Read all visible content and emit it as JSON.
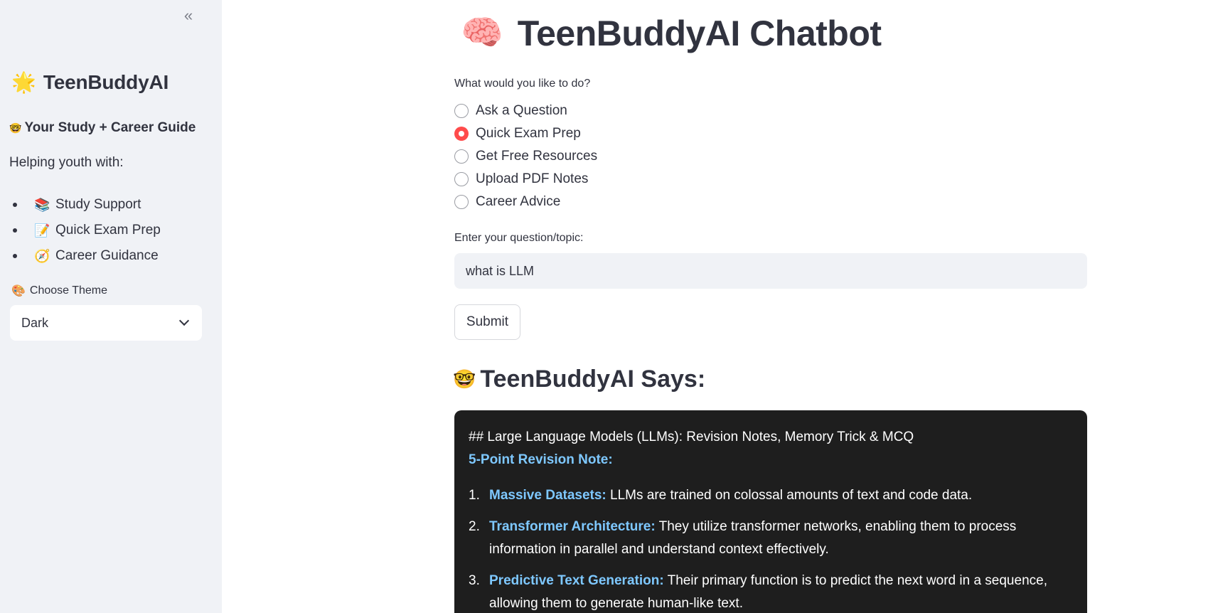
{
  "sidebar": {
    "collapse_icon": "double-chevron-left-icon",
    "collapse_glyph": "«",
    "brand_emoji": "🌟",
    "brand_title": "TeenBuddyAI",
    "tagline_icon": "🤓",
    "tagline": "Your Study + Career Guide",
    "helping_text": "Helping youth with:",
    "features": [
      {
        "icon": "📚",
        "icon_name": "books-icon",
        "label": "Study Support"
      },
      {
        "icon": "📝",
        "icon_name": "memo-icon",
        "label": "Quick Exam Prep"
      },
      {
        "icon": "🧭",
        "icon_name": "compass-icon",
        "label": "Career Guidance"
      }
    ],
    "theme_icon": "🎨",
    "theme_label": "Choose Theme",
    "theme_value": "Dark"
  },
  "main": {
    "title_emoji": "🧠",
    "title": "TeenBuddyAI Chatbot",
    "prompt_label": "What would you like to do?",
    "options": [
      {
        "label": "Ask a Question",
        "selected": false
      },
      {
        "label": "Quick Exam Prep",
        "selected": true
      },
      {
        "label": "Get Free Resources",
        "selected": false
      },
      {
        "label": "Upload PDF Notes",
        "selected": false
      },
      {
        "label": "Career Advice",
        "selected": false
      }
    ],
    "input_label": "Enter your question/topic:",
    "input_value": "what is LLM",
    "submit_label": "Submit",
    "says_icon": "🤓",
    "says_heading": "TeenBuddyAI Says:",
    "response": {
      "heading": "## Large Language Models (LLMs): Revision Notes, Memory Trick & MCQ",
      "subheading": "5-Point Revision Note:",
      "items": [
        {
          "num": "1.",
          "term": "Massive Datasets:",
          "text": " LLMs are trained on colossal amounts of text and code data."
        },
        {
          "num": "2.",
          "term": "Transformer Architecture:",
          "text": " They utilize transformer networks, enabling them to process information in parallel and understand context effectively."
        },
        {
          "num": "3.",
          "term": "Predictive Text Generation:",
          "text": " Their primary function is to predict the next word in a sequence, allowing them to generate human-like text."
        }
      ]
    }
  },
  "colors": {
    "accent": "#ff4b4b",
    "sidebar_bg": "#f0f2f6",
    "response_bg": "#1e1e1e",
    "response_term": "#7ec8ff"
  }
}
